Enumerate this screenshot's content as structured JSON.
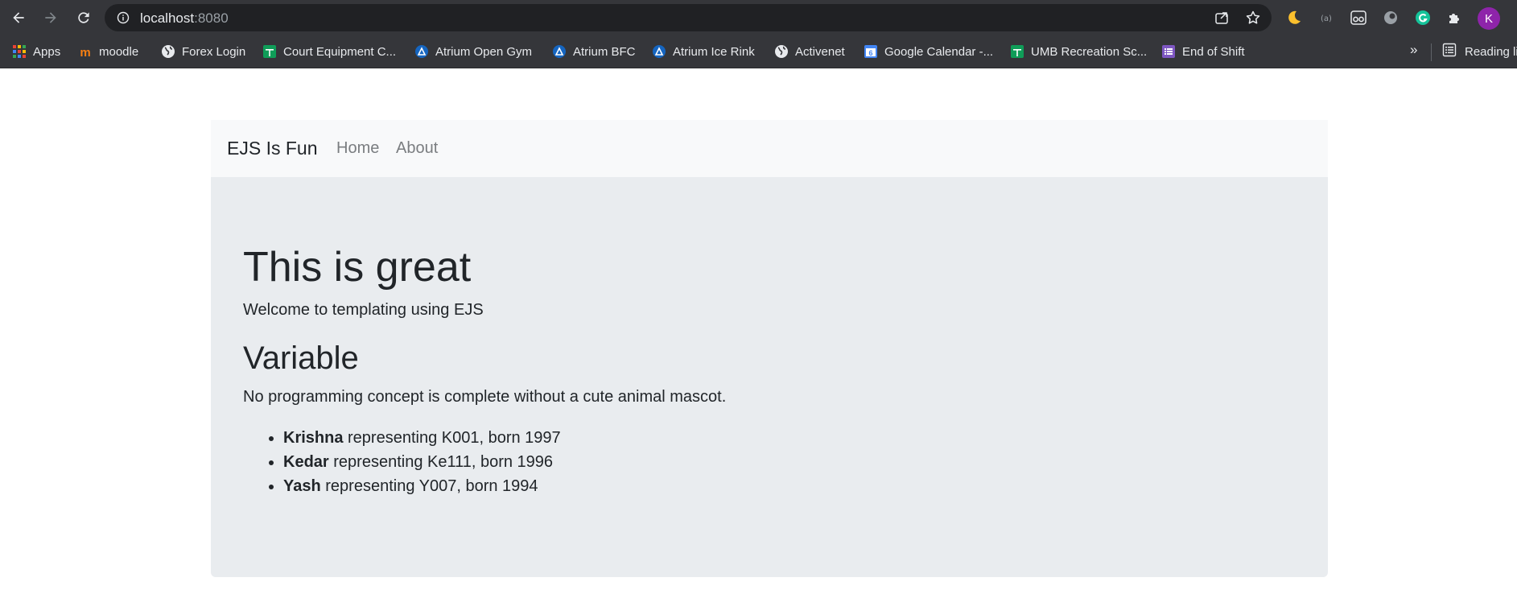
{
  "browser": {
    "url_host": "localhost",
    "url_port": ":8080",
    "profile_initial": "K",
    "bookmarks": [
      {
        "label": "Apps",
        "icon": "apps-grid-icon"
      },
      {
        "label": "moodle",
        "icon": "moodle-icon"
      },
      {
        "label": "Forex Login",
        "icon": "globe-icon"
      },
      {
        "label": "Court Equipment C...",
        "icon": "sheets-icon"
      },
      {
        "label": "Atrium Open Gym",
        "icon": "atrium-icon"
      },
      {
        "label": "Atrium BFC",
        "icon": "atrium-icon"
      },
      {
        "label": "Atrium Ice Rink",
        "icon": "atrium-icon"
      },
      {
        "label": "Activenet",
        "icon": "globe-icon"
      },
      {
        "label": "Google Calendar -...",
        "icon": "calendar-icon"
      },
      {
        "label": "UMB Recreation Sc...",
        "icon": "sheets-icon"
      },
      {
        "label": "End of Shift",
        "icon": "forms-icon"
      }
    ],
    "more_label": "»",
    "reading_list_label": "Reading li"
  },
  "navbar": {
    "brand": "EJS Is Fun",
    "links": [
      "Home",
      "About"
    ]
  },
  "content": {
    "title": "This is great",
    "lead": "Welcome to templating using EJS",
    "subtitle": "Variable",
    "description": "No programming concept is complete without a cute animal mascot.",
    "items": [
      {
        "name": "Krishna",
        "text": " representing K001, born 1997"
      },
      {
        "name": "Kedar",
        "text": " representing Ke111, born 1996"
      },
      {
        "name": "Yash",
        "text": " representing Y007, born 1994"
      }
    ]
  },
  "colors": {
    "chrome_bg": "#35363a",
    "omnibox_bg": "#202124",
    "navbar_bg": "#f8f9fa",
    "jumbotron_bg": "#e9ecef",
    "text": "#212529",
    "nav_link": "#7a7d80",
    "profile": "#8e24aa"
  }
}
